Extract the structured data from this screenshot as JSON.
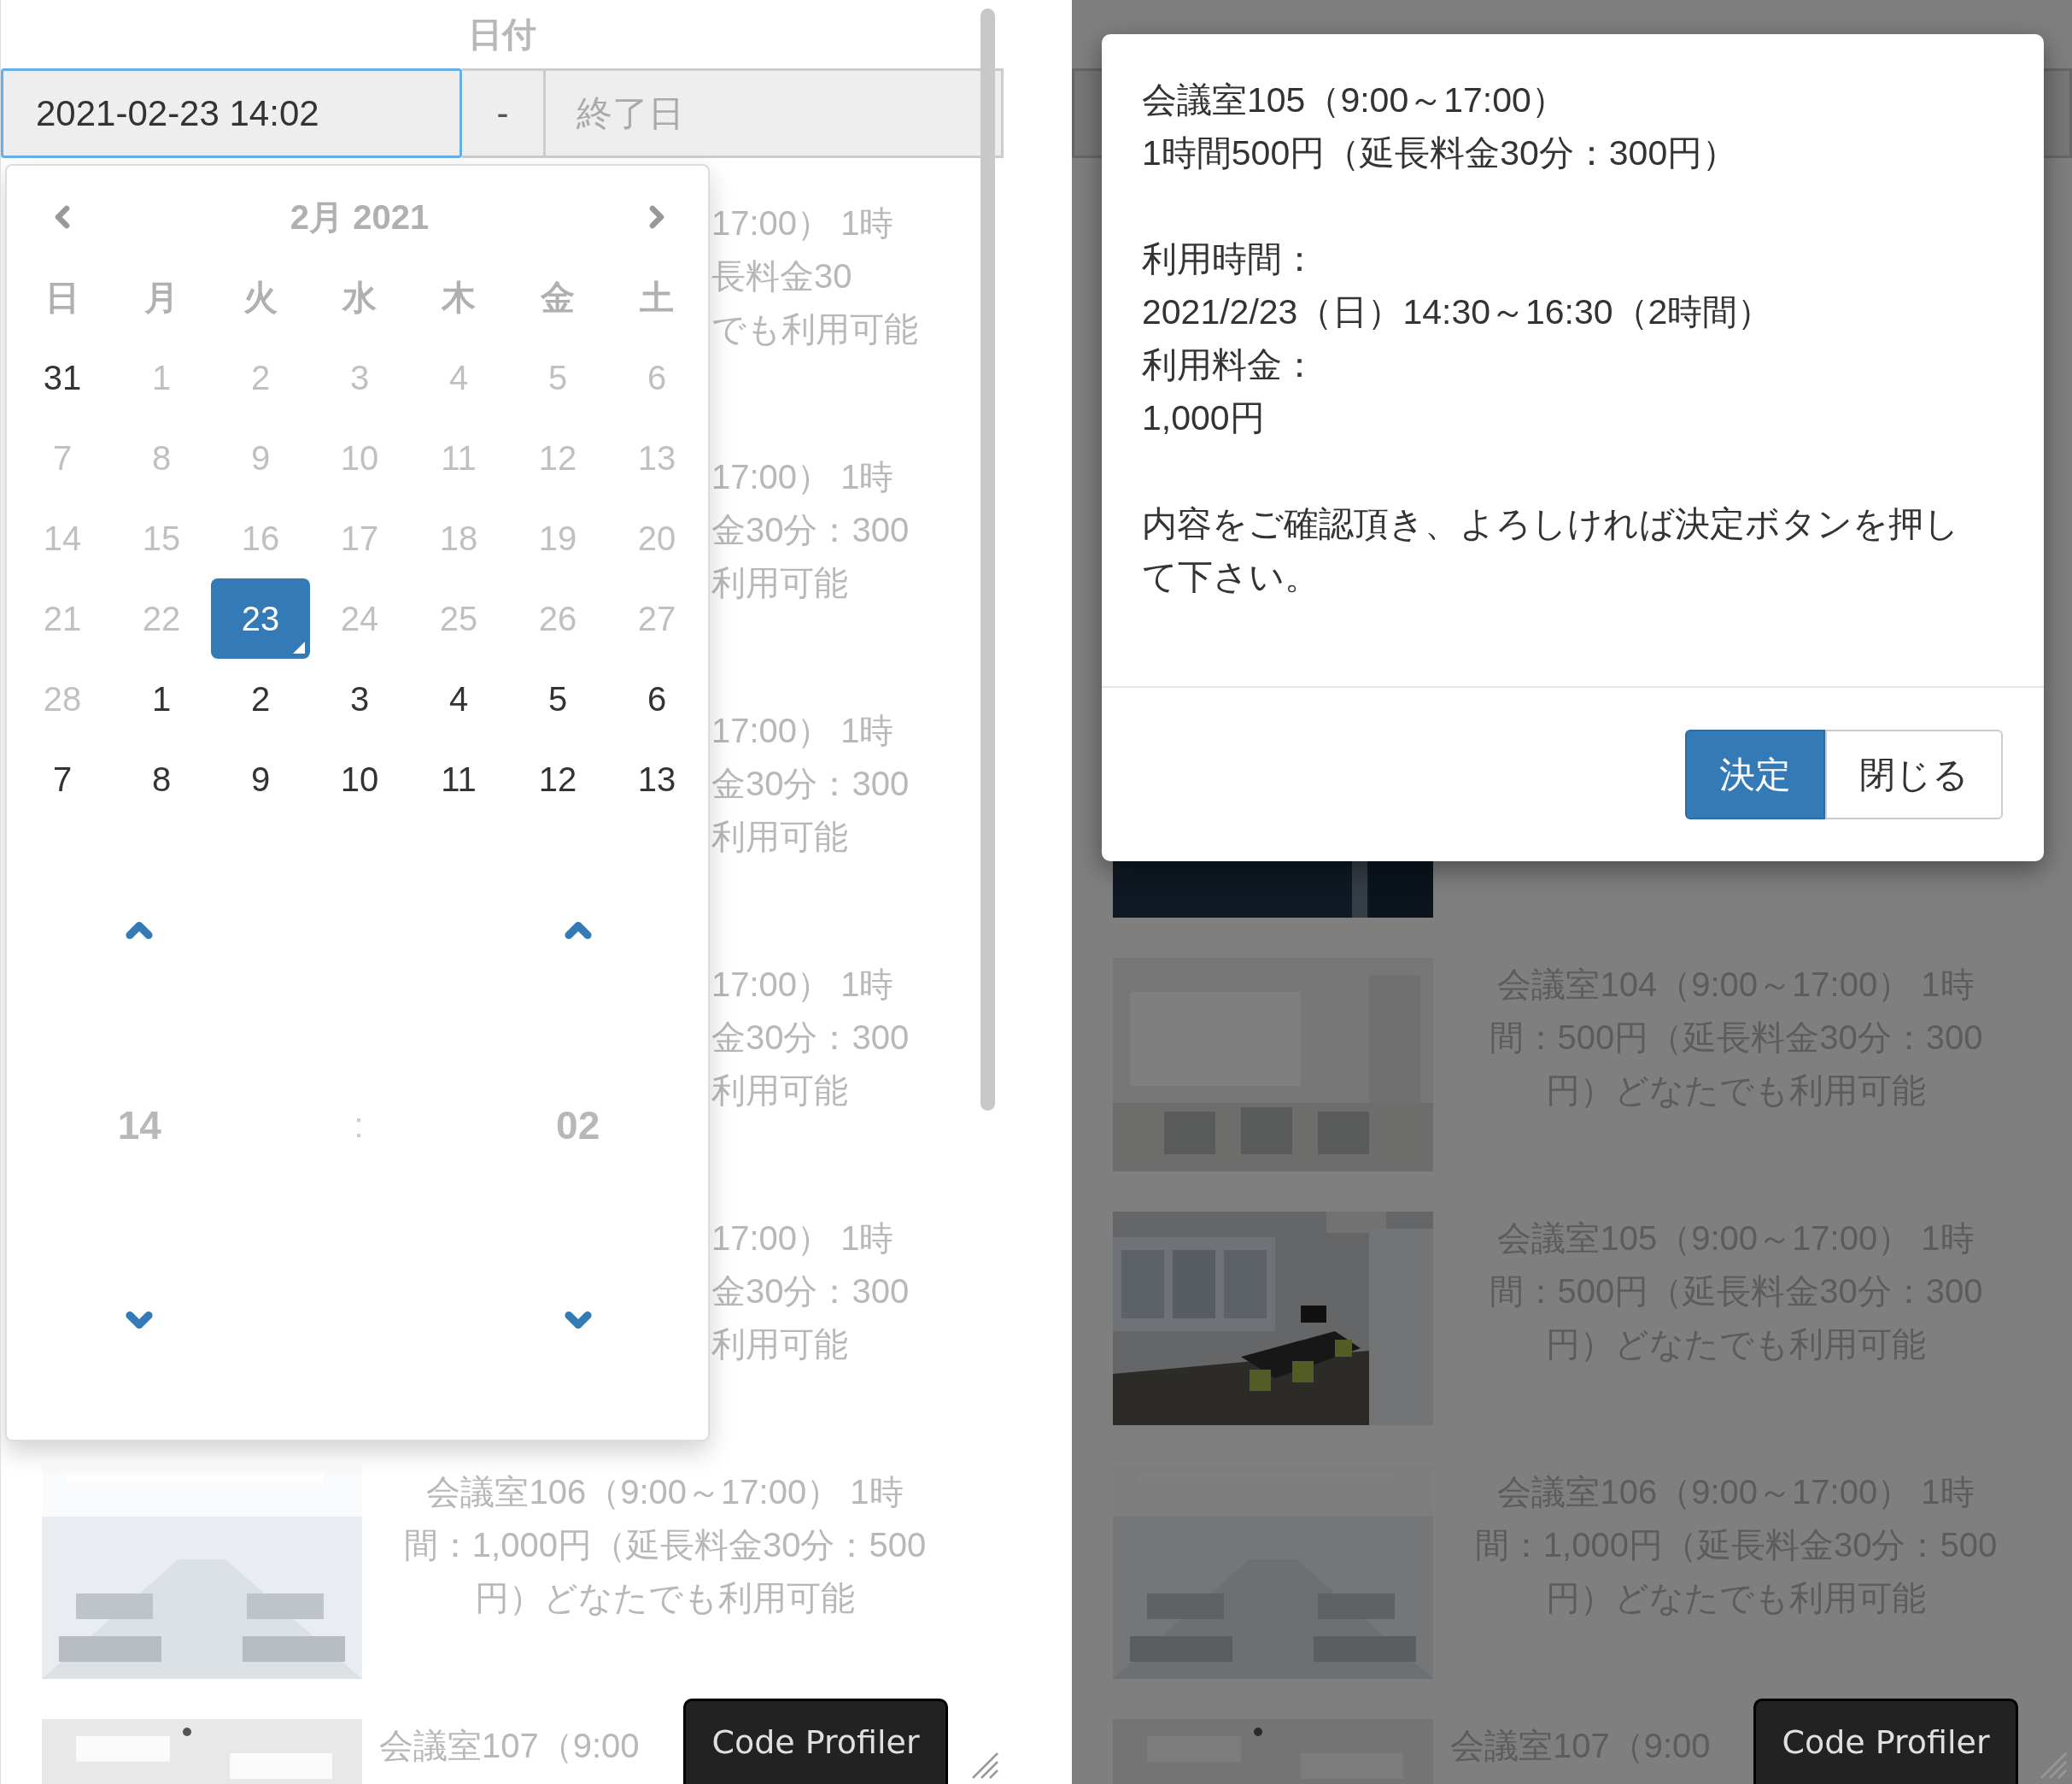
{
  "panels": [
    {
      "kind": "datepicker",
      "header": "日付",
      "start_value": "2021-02-23 14:02",
      "separator": "-",
      "end_placeholder": "終了日",
      "picker": {
        "month": "2月 2021",
        "weekdays": [
          "日",
          "月",
          "火",
          "水",
          "木",
          "金",
          "土"
        ],
        "weeks": [
          [
            {
              "label": "31",
              "disabled": false,
              "selected": false,
              "today": false
            },
            {
              "label": "1",
              "disabled": true,
              "selected": false,
              "today": false
            },
            {
              "label": "2",
              "disabled": true,
              "selected": false,
              "today": false
            },
            {
              "label": "3",
              "disabled": true,
              "selected": false,
              "today": false
            },
            {
              "label": "4",
              "disabled": true,
              "selected": false,
              "today": false
            },
            {
              "label": "5",
              "disabled": true,
              "selected": false,
              "today": false
            },
            {
              "label": "6",
              "disabled": true,
              "selected": false,
              "today": false
            }
          ],
          [
            {
              "label": "7",
              "disabled": true,
              "selected": false,
              "today": false
            },
            {
              "label": "8",
              "disabled": true,
              "selected": false,
              "today": false
            },
            {
              "label": "9",
              "disabled": true,
              "selected": false,
              "today": false
            },
            {
              "label": "10",
              "disabled": true,
              "selected": false,
              "today": false
            },
            {
              "label": "11",
              "disabled": true,
              "selected": false,
              "today": false
            },
            {
              "label": "12",
              "disabled": true,
              "selected": false,
              "today": false
            },
            {
              "label": "13",
              "disabled": true,
              "selected": false,
              "today": false
            }
          ],
          [
            {
              "label": "14",
              "disabled": true,
              "selected": false,
              "today": false
            },
            {
              "label": "15",
              "disabled": true,
              "selected": false,
              "today": false
            },
            {
              "label": "16",
              "disabled": true,
              "selected": false,
              "today": false
            },
            {
              "label": "17",
              "disabled": true,
              "selected": false,
              "today": false
            },
            {
              "label": "18",
              "disabled": true,
              "selected": false,
              "today": false
            },
            {
              "label": "19",
              "disabled": true,
              "selected": false,
              "today": false
            },
            {
              "label": "20",
              "disabled": true,
              "selected": false,
              "today": false
            }
          ],
          [
            {
              "label": "21",
              "disabled": true,
              "selected": false,
              "today": false
            },
            {
              "label": "22",
              "disabled": true,
              "selected": false,
              "today": false
            },
            {
              "label": "23",
              "disabled": false,
              "selected": true,
              "today": true
            },
            {
              "label": "24",
              "disabled": true,
              "selected": false,
              "today": false
            },
            {
              "label": "25",
              "disabled": true,
              "selected": false,
              "today": false
            },
            {
              "label": "26",
              "disabled": true,
              "selected": false,
              "today": false
            },
            {
              "label": "27",
              "disabled": true,
              "selected": false,
              "today": false
            }
          ],
          [
            {
              "label": "28",
              "disabled": true,
              "selected": false,
              "today": false
            },
            {
              "label": "1",
              "disabled": false,
              "selected": false,
              "today": false
            },
            {
              "label": "2",
              "disabled": false,
              "selected": false,
              "today": false
            },
            {
              "label": "3",
              "disabled": false,
              "selected": false,
              "today": false
            },
            {
              "label": "4",
              "disabled": false,
              "selected": false,
              "today": false
            },
            {
              "label": "5",
              "disabled": false,
              "selected": false,
              "today": false
            },
            {
              "label": "6",
              "disabled": false,
              "selected": false,
              "today": false
            }
          ],
          [
            {
              "label": "7",
              "disabled": false,
              "selected": false,
              "today": false
            },
            {
              "label": "8",
              "disabled": false,
              "selected": false,
              "today": false
            },
            {
              "label": "9",
              "disabled": false,
              "selected": false,
              "today": false
            },
            {
              "label": "10",
              "disabled": false,
              "selected": false,
              "today": false
            },
            {
              "label": "11",
              "disabled": false,
              "selected": false,
              "today": false
            },
            {
              "label": "12",
              "disabled": false,
              "selected": false,
              "today": false
            },
            {
              "label": "13",
              "disabled": false,
              "selected": false,
              "today": false
            }
          ]
        ],
        "hour": "14",
        "time_separator": ":",
        "minute": "02"
      },
      "rooms": [
        {
          "kind": "fragment",
          "lines": [
            "17:00） 1時",
            "長料金30",
            "でも利用可能"
          ]
        },
        {
          "kind": "fragment",
          "lines": [
            "17:00） 1時",
            "金30分：300",
            "利用可能"
          ]
        },
        {
          "kind": "fragment",
          "lines": [
            "17:00） 1時",
            "金30分：300",
            "利用可能"
          ]
        },
        {
          "kind": "fragment",
          "lines": [
            "17:00） 1時",
            "金30分：300",
            "利用可能"
          ]
        },
        {
          "kind": "fragment",
          "lines": [
            "17:00） 1時",
            "金30分：300",
            "利用可能"
          ]
        },
        {
          "kind": "room",
          "picture": true,
          "faded": true,
          "lines": [
            "会議室106（9:00～17:00） 1時",
            "間：1,000円（延長料金30分：500",
            "円）どなたでも利用可能"
          ]
        },
        {
          "kind": "partial",
          "picture": true,
          "faded": false,
          "lines": [
            "会議室107（9:00"
          ]
        }
      ],
      "profiler": "Code Profiler"
    },
    {
      "kind": "dialog",
      "modal": {
        "sections": [
          [
            "会議室105（9:00～17:00）",
            "1時間500円（延長料金30分：300円）"
          ],
          [
            "利用時間：",
            "2021/2/23（日）14:30～16:30（2時間）",
            "利用料金：",
            "1,000円"
          ],
          [
            "内容をご確認頂き、よろしければ決定ボタンを押して下さい。"
          ]
        ],
        "buttons": [
          {
            "label": "決定",
            "primary": true
          },
          {
            "label": "閉じる",
            "primary": false
          }
        ]
      },
      "rooms": [
        {
          "kind": "room",
          "picture": true,
          "faded": false
        },
        {
          "kind": "room",
          "picture": true,
          "faded": true,
          "lines": [
            "会議室104（9:00～17:00） 1時",
            "間：500円（延長料金30分：300",
            "円）どなたでも利用可能"
          ]
        },
        {
          "kind": "room",
          "picture": true,
          "faded": false,
          "lines": [
            "会議室105（9:00～17:00） 1時",
            "間：500円（延長料金30分：300",
            "円）どなたでも利用可能"
          ]
        },
        {
          "kind": "room",
          "picture": true,
          "faded": true,
          "lines": [
            "会議室106（9:00～17:00） 1時",
            "間：1,000円（延長料金30分：500",
            "円）どなたでも利用可能"
          ]
        },
        {
          "kind": "partial",
          "picture": true,
          "faded": false,
          "lines": [
            "会議室107（9:00"
          ]
        }
      ],
      "profiler": "Code Profiler"
    }
  ]
}
